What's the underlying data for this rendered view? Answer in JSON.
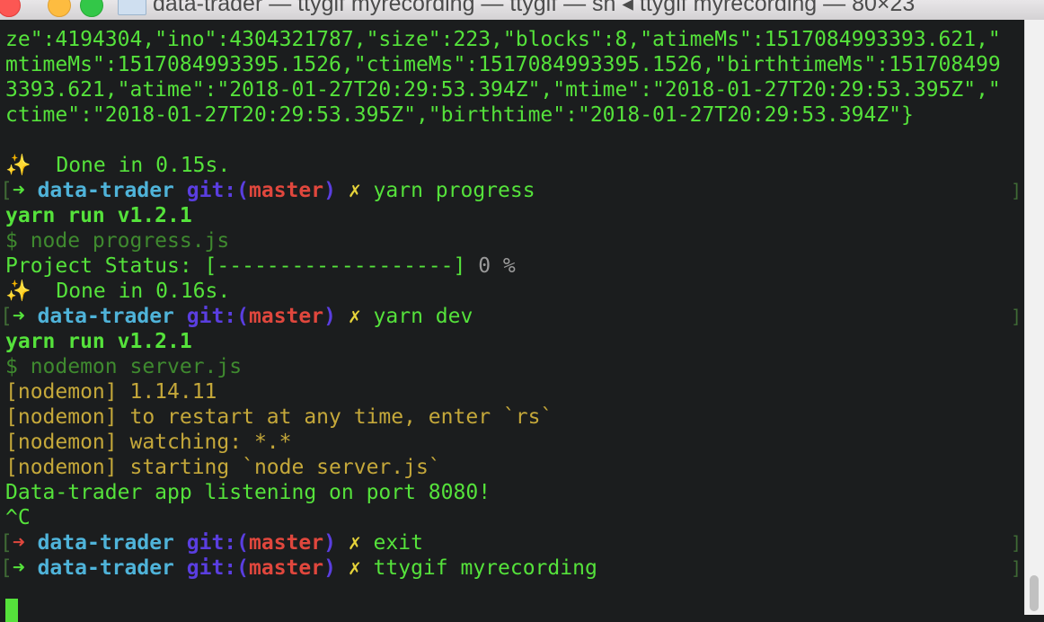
{
  "window": {
    "title": "data-trader — ttygif myrecording — ttygif — sh ◂ ttygif myrecording — 80×23"
  },
  "terminal": {
    "json_lines": [
      "ze\":4194304,\"ino\":4304321787,\"size\":223,\"blocks\":8,\"atimeMs\":1517084993393.621,\"",
      "mtimeMs\":1517084993395.1526,\"ctimeMs\":1517084993395.1526,\"birthtimeMs\":151708499",
      "3393.621,\"atime\":\"2018-01-27T20:29:53.394Z\",\"mtime\":\"2018-01-27T20:29:53.395Z\",\"",
      "ctime\":\"2018-01-27T20:29:53.395Z\",\"birthtime\":\"2018-01-27T20:29:53.394Z\"}"
    ],
    "sparkle": "✨",
    "done_1": "Done in 0.15s.",
    "done_2": "Done in 0.16s.",
    "bracket_open": "[",
    "bracket_close": "]",
    "prompt": {
      "arrow": "➜",
      "dir": "data-trader",
      "git": "git:(",
      "branch": "master",
      "git_close": ")",
      "dirty": "✗"
    },
    "cmd_1": "yarn progress",
    "cmd_2": "yarn dev",
    "cmd_3": "exit",
    "cmd_4": "ttygif myrecording",
    "yarn_run": "yarn run v1.2.1",
    "node_progress": "$ node progress.js",
    "status_label": "Project Status: [-------------------]",
    "status_pct": "0 %",
    "nodemon_cmd": "$ nodemon server.js",
    "nodemon_1": "[nodemon] 1.14.11",
    "nodemon_2": "[nodemon] to restart at any time, enter `rs`",
    "nodemon_3": "[nodemon] watching: *.*",
    "nodemon_4": "[nodemon] starting `node server.js`",
    "listening": "Data-trader app listening on port 8080!",
    "ctrl_c": "^C"
  },
  "colors": {
    "green": "#55e23b",
    "cyan": "#4fb3d9",
    "blue": "#5a3ee0",
    "red": "#e0473d",
    "yellow": "#e6d33a",
    "nodemon": "#c5a83a"
  }
}
